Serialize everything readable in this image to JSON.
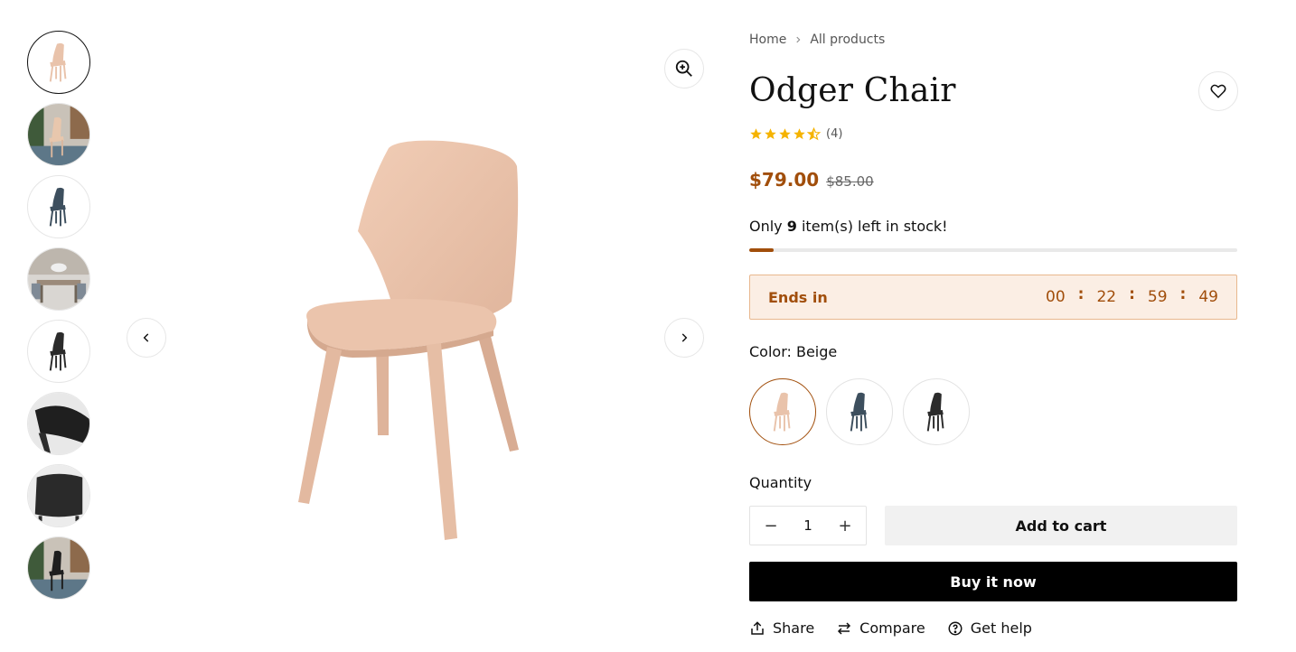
{
  "thumbnails": [
    {
      "name": "beige-chair-front"
    },
    {
      "name": "beige-chair-room"
    },
    {
      "name": "blue-chair"
    },
    {
      "name": "dining-room"
    },
    {
      "name": "black-chair"
    },
    {
      "name": "black-chair-detail"
    },
    {
      "name": "black-seat-detail"
    },
    {
      "name": "black-chair-room"
    }
  ],
  "breadcrumb": {
    "home": "Home",
    "current": "All products"
  },
  "product": {
    "title": "Odger Chair",
    "rating": 4.5,
    "review_count": "(4)",
    "price": "$79.00",
    "compare_price": "$85.00"
  },
  "stock": {
    "prefix": "Only",
    "count": "9",
    "suffix": "item(s) left in stock!",
    "level": 0.05
  },
  "countdown": {
    "label": "Ends in",
    "days": "00",
    "hours": "22",
    "minutes": "59",
    "seconds": "49"
  },
  "color": {
    "label": "Color:",
    "selected": "Beige",
    "options": [
      "Beige",
      "Blue",
      "Black"
    ]
  },
  "quantity": {
    "label": "Quantity",
    "value": "1",
    "minus": "−",
    "plus": "+"
  },
  "buttons": {
    "add_to_cart": "Add to cart",
    "buy_now": "Buy it now"
  },
  "actions": {
    "share": "Share",
    "compare": "Compare",
    "help": "Get help"
  },
  "colors": {
    "accent": "#a14e0b",
    "timer_bg": "#fbeee4",
    "star": "#f5b301",
    "beige": "#e9c3ab",
    "blue": "#3d4f5e",
    "black": "#2b2b2b"
  }
}
